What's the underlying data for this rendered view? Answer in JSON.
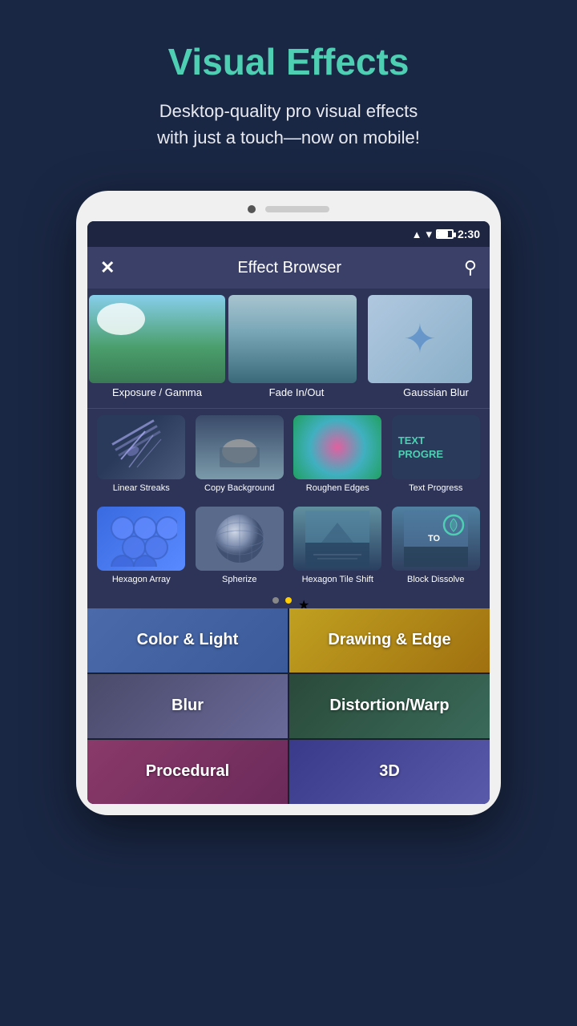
{
  "header": {
    "title": "Visual Effects",
    "subtitle": "Desktop-quality pro visual effects\nwith just a touch—now on mobile!"
  },
  "status_bar": {
    "time": "2:30"
  },
  "toolbar": {
    "title": "Effect Browser",
    "close_icon": "×",
    "search_icon": "🔍"
  },
  "horizontal_effects": [
    {
      "label": "Exposure / Gamma",
      "thumb": "sky"
    },
    {
      "label": "Fade In/Out",
      "thumb": "lake"
    },
    {
      "label": "Gaussian Blur",
      "thumb": "blur"
    }
  ],
  "grid_effects_row1": [
    {
      "label": "Linear Streaks",
      "thumb": "linear"
    },
    {
      "label": "Copy Background",
      "thumb": "copy-bg"
    },
    {
      "label": "Roughen Edges",
      "thumb": "roughen"
    },
    {
      "label": "Text Progress",
      "thumb": "text-prog"
    }
  ],
  "grid_effects_row2": [
    {
      "label": "Hexagon Array",
      "thumb": "hexarray"
    },
    {
      "label": "Spherize",
      "thumb": "spherize"
    },
    {
      "label": "Hexagon Tile Shift",
      "thumb": "hextile"
    },
    {
      "label": "Block Dissolve",
      "thumb": "blockdissolve"
    }
  ],
  "pagination": {
    "dots": [
      "inactive",
      "active",
      "star"
    ]
  },
  "categories": [
    {
      "label": "Color & Light",
      "style": "cat-color-light"
    },
    {
      "label": "Drawing & Edge",
      "style": "cat-drawing"
    },
    {
      "label": "Blur",
      "style": "cat-blur"
    },
    {
      "label": "Distortion/Warp",
      "style": "cat-distortion"
    },
    {
      "label": "Procedural",
      "style": "cat-procedural"
    },
    {
      "label": "3D",
      "style": "cat-3d"
    }
  ]
}
